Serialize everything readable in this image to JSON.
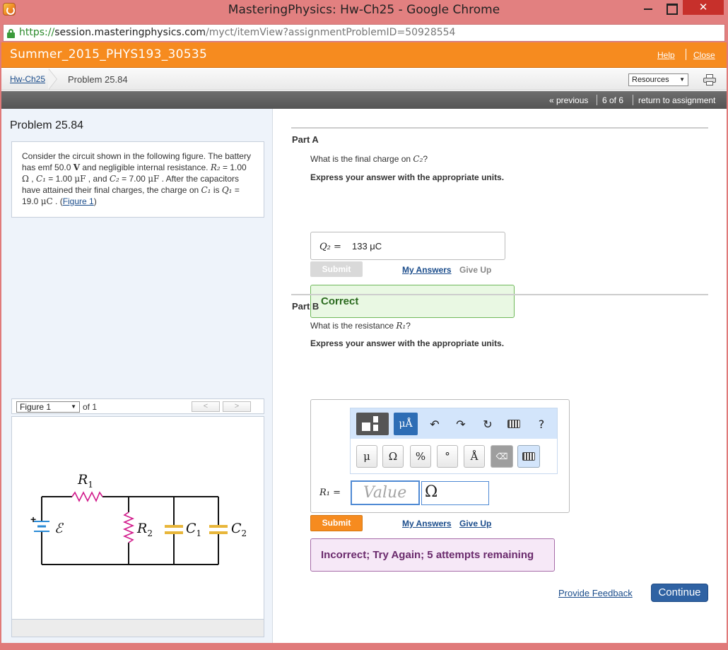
{
  "window": {
    "title": "MasteringPhysics: Hw-Ch25 - Google Chrome",
    "close_glyph": "✕"
  },
  "address": {
    "scheme": "https://",
    "host": "session.masteringphysics.com",
    "path": "/myct/itemView?assignmentProblemID=50928554"
  },
  "header": {
    "course": "Summer_2015_PHYS193_30535",
    "help": "Help",
    "close": "Close"
  },
  "breadcrumb": {
    "assignment": "Hw-Ch25",
    "problem": "Problem 25.84",
    "resources_select": "Resources"
  },
  "nav": {
    "previous": "« previous",
    "count": "6 of 6",
    "return": "return to assignment"
  },
  "problem": {
    "title": "Problem 25.84",
    "text_1": "Consider the circuit shown in the following figure. The battery has emf 50.0 ",
    "text_V": "V",
    "text_2": " and negligible internal resistance. ",
    "R2": "R₂",
    "text_3": " = 1.00 ",
    "ohm": "Ω",
    "text_4": " , ",
    "C1": "C₁",
    "text_5": " = 1.00 ",
    "uF": "μF",
    "text_6": " , and ",
    "C2": "C₂",
    "text_7": " = 7.00 ",
    "text_8": " . After the capacitors have attained their final charges, the charge on ",
    "text_9": " is ",
    "Q1": "Q₁",
    "text_10": " = 19.0 ",
    "uC": "μC",
    "text_11": " . (",
    "figure_link": "Figure 1",
    "text_12": ")"
  },
  "figure": {
    "select": "Figure 1",
    "of": "of 1",
    "prev": "<",
    "next": ">",
    "labels": {
      "R1": "R",
      "R1_sub": "1",
      "R2": "R",
      "R2_sub": "2",
      "C1": "C",
      "C1_sub": "1",
      "C2": "C",
      "C2_sub": "2",
      "emf": "ℰ",
      "plus": "+"
    }
  },
  "partA": {
    "title": "Part A",
    "question_1": "What is the final charge on ",
    "question_var": "C₂",
    "question_2": "?",
    "express": "Express your answer with the appropriate units.",
    "lhs": "Q₂ =",
    "value": "133 μC",
    "submit": "Submit",
    "my_answers": "My Answers",
    "give_up": "Give Up",
    "result": "Correct"
  },
  "partB": {
    "title": "Part B",
    "question_1": "What is the resistance ",
    "question_var": "R₁",
    "question_2": "?",
    "express": "Express your answer with the appropriate units.",
    "toolbar": {
      "units_label": "μÅ",
      "help": "?",
      "keys": [
        "μ",
        "Ω",
        "%",
        "°",
        "Å"
      ]
    },
    "lhs": "R₁ =",
    "value_placeholder": "Value",
    "unit": "Ω",
    "submit": "Submit",
    "my_answers": "My Answers",
    "give_up": "Give Up",
    "result": "Incorrect; Try Again; 5 attempts remaining"
  },
  "footer": {
    "feedback": "Provide Feedback",
    "continue": "Continue"
  },
  "colors": {
    "orange": "#f68b1f",
    "link": "#1a4c8b",
    "circuit_wire": "#111111",
    "resistor": "#d1188a",
    "capacitor": "#e8b63a",
    "battery": "#2a8bd6"
  }
}
